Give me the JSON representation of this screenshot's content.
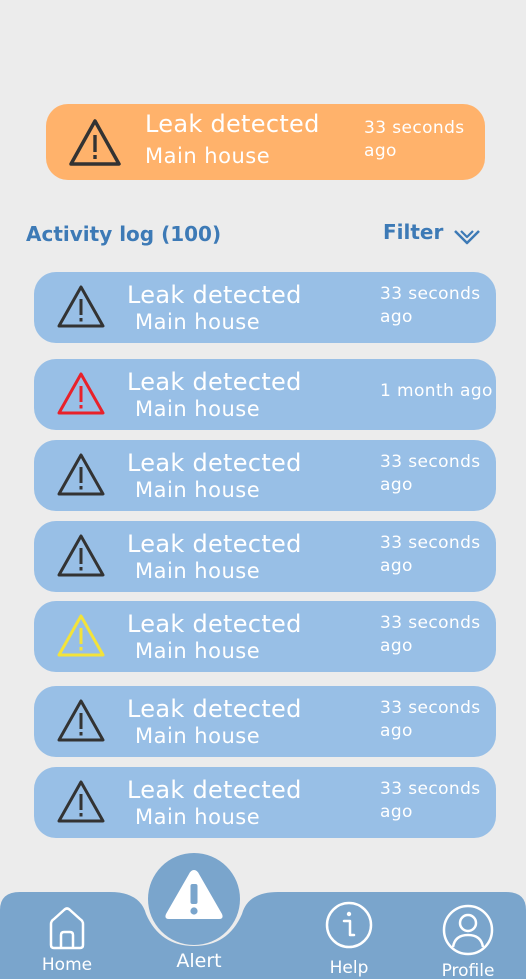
{
  "banner": {
    "title": "Leak detected",
    "subtitle": "Main house",
    "time": "33 seconds ago",
    "icon": "warning-triangle-icon",
    "color": "#ffb26b"
  },
  "activity": {
    "title": "Activity log (100)",
    "filter_label": "Filter"
  },
  "items": [
    {
      "title": "Leak detected",
      "subtitle": "Main house",
      "time": "33 seconds ago",
      "icon_color": "#333333"
    },
    {
      "title": "Leak detected",
      "subtitle": "Main house",
      "time": "1 month ago",
      "icon_color": "#e8212a"
    },
    {
      "title": "Leak detected",
      "subtitle": "Main house",
      "time": "33 seconds ago",
      "icon_color": "#333333"
    },
    {
      "title": "Leak detected",
      "subtitle": "Main house",
      "time": "33 seconds ago",
      "icon_color": "#333333"
    },
    {
      "title": "Leak detected",
      "subtitle": "Main house",
      "time": "33 seconds ago",
      "icon_color": "#f3e33a"
    },
    {
      "title": "Leak detected",
      "subtitle": "Main house",
      "time": "33 seconds ago",
      "icon_color": "#333333"
    },
    {
      "title": "Leak detected",
      "subtitle": "Main house",
      "time": "33 seconds ago",
      "icon_color": "#333333"
    }
  ],
  "nav": {
    "home": "Home",
    "alert": "Alert",
    "help": "Help",
    "profile": "Profile"
  },
  "colors": {
    "background": "#ececec",
    "item": "#98bfe6",
    "nav": "#7aa5cc",
    "heading": "#3d7ab6"
  }
}
